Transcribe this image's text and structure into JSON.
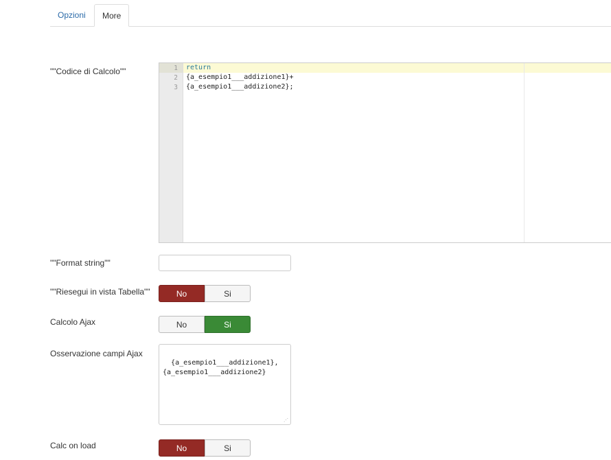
{
  "tabs": [
    {
      "label": "Opzioni",
      "active": false
    },
    {
      "label": "More",
      "active": true
    }
  ],
  "fields": {
    "codice_label": "\"\"Codice di Calcolo\"\"",
    "format_label": "\"\"Format string\"\"",
    "format_value": "",
    "riesegui_label": "\"\"Riesegui in vista Tabella\"\"",
    "ajax_label": "Calcolo Ajax",
    "osservazione_label": "Osservazione campi Ajax",
    "osservazione_value": "{a_esempio1___addizione1},\n{a_esempio1___addizione2}",
    "calc_on_load_label": "Calc on load"
  },
  "editor": {
    "line_numbers": [
      "1",
      "2",
      "3"
    ],
    "lines": [
      "return",
      "{a_esempio1___addizione1}+",
      "{a_esempio1___addizione2};"
    ]
  },
  "toggles": {
    "no_label": "No",
    "si_label": "Si",
    "riesegui_selected": "No",
    "ajax_selected": "Si",
    "calc_on_load_selected": "No"
  },
  "colors": {
    "no_active": "#942a25",
    "si_active": "#3a8a36",
    "tab_link": "#2a6aa8",
    "active_line": "#fcfad4"
  }
}
